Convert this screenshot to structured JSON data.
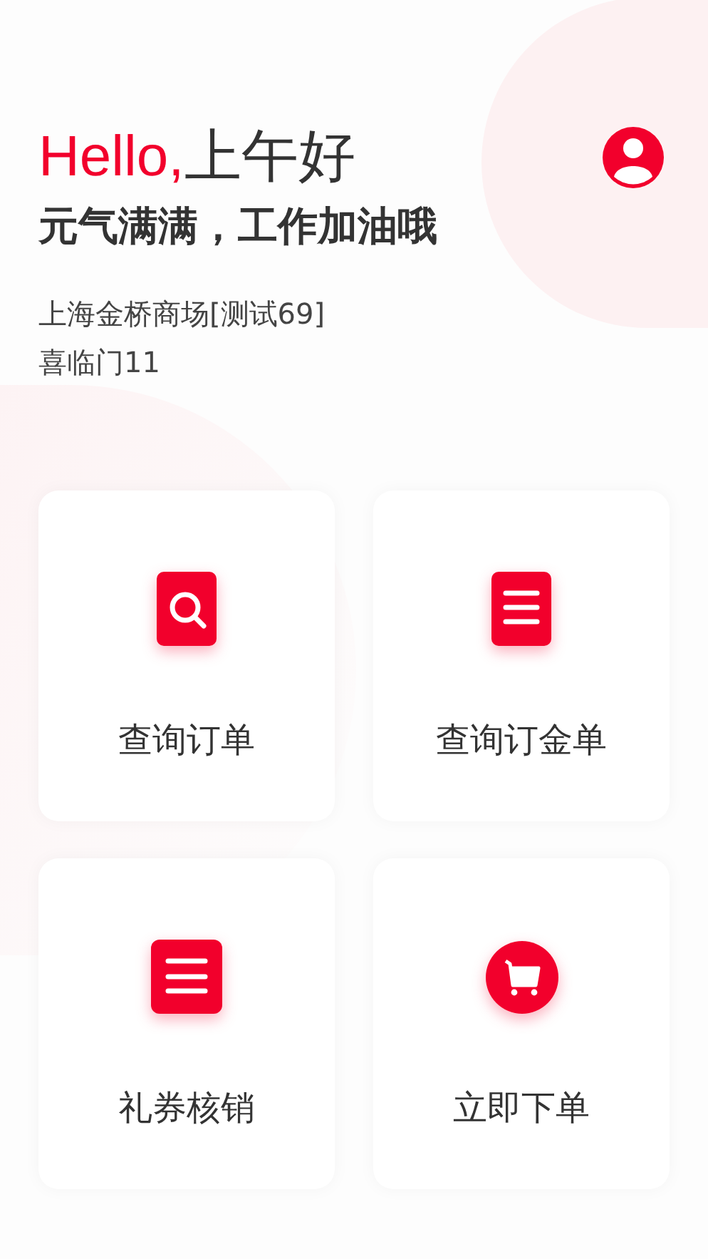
{
  "greeting": {
    "hello": "Hello,",
    "time_of_day": "上午好"
  },
  "subtitle": "元气满满，工作加油哦",
  "store": {
    "name": "上海金桥商场[测试69]",
    "counter": "喜临门11"
  },
  "actions": [
    {
      "kind": "search",
      "label": "查询订单"
    },
    {
      "kind": "document",
      "label": "查询订金单"
    },
    {
      "kind": "list",
      "label": "礼券核销"
    },
    {
      "kind": "cart",
      "label": "立即下单"
    }
  ]
}
